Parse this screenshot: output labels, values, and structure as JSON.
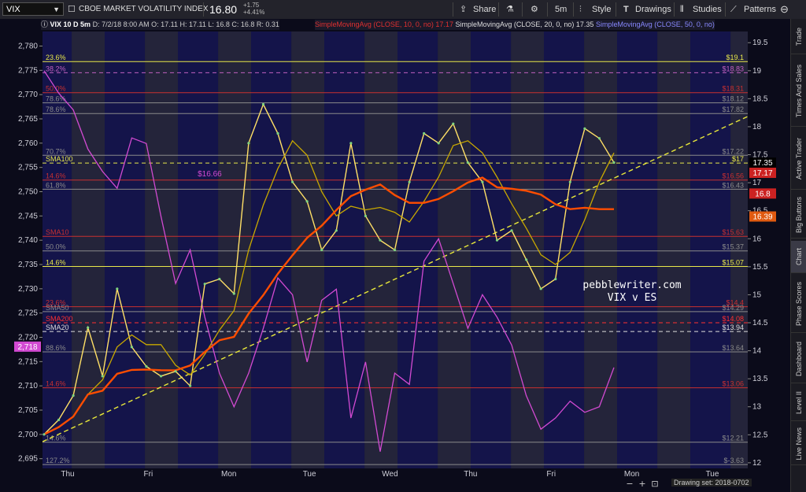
{
  "toolbar": {
    "symbol": "VIX",
    "instrument_name": "CBOE MARKET VOLATILITY INDEX",
    "last_price": "16.80",
    "change_abs": "+1.75",
    "change_pct": "+4.41%",
    "share": "Share",
    "timeframe": "5m",
    "style": "Style",
    "drawings": "Drawings",
    "studies": "Studies",
    "patterns": "Patterns"
  },
  "sidebar": {
    "tabs": [
      "Trade",
      "Times And Sales",
      "Active Trader",
      "Big Buttons",
      "Chart",
      "Phase Scores",
      "Dashboard",
      "Level II",
      "Live News"
    ],
    "active": "Chart"
  },
  "header": {
    "title": "VIX 10 D 5m",
    "date_info": "D: 7/2/18 8:00 AM",
    "ohlc": "O: 17.11 H: 17.11 L: 16.8 C: 16.8 R: 0.31",
    "sma10": "SimpleMovingAvg (CLOSE, 10, 0, no)",
    "sma10_val": "17.17",
    "sma20": "SimpleMovingAvg (CLOSE, 20, 0, no)",
    "sma20_val": "17.35",
    "sma50": "SimpleMovingAvg (CLOSE, 50, 0, no)"
  },
  "footer": {
    "drawing_set": "Drawing set: 2018-0702"
  },
  "colors": {
    "background": "#0b0b1a",
    "band_dark": "#14144a",
    "band_light": "#3a3a56",
    "vix_line": "#d24ad2",
    "sma10": "#ff7a1a",
    "sma20": "#c8a800",
    "sma50": "#ff4d00",
    "sma200": "#e03a16",
    "trendline": "#e8e83a",
    "fib_red": "#c83030",
    "fib_gray": "#8a8a8a",
    "fib_yellow": "#e8e84a",
    "watermark": "#ffffff"
  },
  "chart_data": {
    "type": "line",
    "title": "",
    "watermark": [
      "pebblewriter.com",
      "VIX v ES"
    ],
    "xlabel": "",
    "ylabel": "",
    "x_ticks": [
      "Thu",
      "Fri",
      "Mon",
      "Tue",
      "Wed",
      "Thu",
      "Fri",
      "Mon",
      "Tue"
    ],
    "left_axis": {
      "label": "ES",
      "ylim": [
        2693,
        2783
      ],
      "ticks": [
        2780,
        2775,
        2770,
        2765,
        2760,
        2755,
        2750,
        2745,
        2740,
        2735,
        2730,
        2725,
        2720,
        2715,
        2710,
        2705,
        2700,
        2695
      ],
      "marker": "2,718"
    },
    "right_axis": {
      "label": "VIX",
      "ylim": [
        11.9,
        19.7
      ],
      "ticks": [
        19.5,
        19,
        18.5,
        18,
        17.5,
        17,
        16.5,
        16,
        15.5,
        15,
        14.5,
        14,
        13.5,
        13,
        12.5,
        12
      ]
    },
    "price_tags": [
      {
        "label": "17.35",
        "value": 17.35,
        "color": "#ffffff",
        "bg": "#000000"
      },
      {
        "label": "17.17",
        "value": 17.17,
        "color": "#ffffff",
        "bg": "#cc2222"
      },
      {
        "label": "16.8",
        "value": 16.8,
        "color": "#ffffff",
        "bg": "#cc2222"
      },
      {
        "label": "16.39",
        "value": 16.39,
        "color": "#ffffff",
        "bg": "#e05a10"
      }
    ],
    "levels": [
      {
        "left_label": "23.6%",
        "right_label": "$19.1",
        "es": 2776.8,
        "color": "#e8e84a"
      },
      {
        "left_label": "38.2%",
        "right_label": "$18.83",
        "es": 2774.5,
        "color": "#c060c0",
        "dashed": true
      },
      {
        "left_label": "50.0%",
        "right_label": "$18.31",
        "es": 2770.4,
        "color": "#c83030"
      },
      {
        "left_label": "78.6%",
        "right_label": "$18.12",
        "es": 2768.3,
        "color": "#8a8a8a"
      },
      {
        "left_label": "78.6%",
        "right_label": "$17.82",
        "es": 2766.1,
        "color": "#8a8a8a"
      },
      {
        "left_label": "70.7%",
        "right_label": "$17.22",
        "es": 2757.5,
        "color": "#8a8a8a"
      },
      {
        "left_label": "SMA100",
        "right_label": "$17",
        "es": 2755.9,
        "color": "#e8e84a",
        "dashed": true
      },
      {
        "left_label": "14.6%",
        "right_label": "$16.56",
        "es": 2752.4,
        "color": "#c83030"
      },
      {
        "left_label": "61.8%",
        "right_label": "$16.43",
        "es": 2750.5,
        "color": "#8a8a8a"
      },
      {
        "left_label": "SMA10",
        "right_label": "$15.63",
        "es": 2740.8,
        "color": "#c83030"
      },
      {
        "left_label": "50.0%",
        "right_label": "$15.37",
        "es": 2737.8,
        "color": "#8a8a8a"
      },
      {
        "left_label": "14.6%",
        "right_label": "$15.07",
        "es": 2734.6,
        "color": "#e8e84a"
      },
      {
        "left_label": "23.6%",
        "right_label": "$14.4",
        "es": 2726.3,
        "color": "#c83030"
      },
      {
        "left_label": "SMA50",
        "right_label": "$14.29",
        "es": 2725.3,
        "color": "#8a8a8a"
      },
      {
        "left_label": "SMA200",
        "right_label": "$14.08",
        "es": 2723.0,
        "color": "#ff3030",
        "dashed": true
      },
      {
        "left_label": "SMA20",
        "right_label": "$13.94",
        "es": 2721.2,
        "color": "#dddddd",
        "dashed": true
      },
      {
        "left_label": "88.6%",
        "right_label": "$13.64",
        "es": 2717.0,
        "color": "#8a8a8a"
      },
      {
        "left_label": "14.6%",
        "right_label": "$13.06",
        "es": 2709.6,
        "color": "#c83030"
      },
      {
        "left_label": "14.6%",
        "right_label": "$12.21",
        "es": 2698.4,
        "color": "#8a8a8a"
      },
      {
        "left_label": "127.2%",
        "right_label": "$-3.63",
        "es": 2693.8,
        "color": "#8a8a8a"
      }
    ],
    "annotations": [
      {
        "text": "$16.66",
        "es": 2752.5,
        "x_frac": 0.22
      }
    ],
    "series": [
      {
        "name": "ES",
        "axis": "left",
        "values": [
          2700,
          2703,
          2708,
          2722,
          2712,
          2730,
          2718,
          2714,
          2712,
          2713,
          2710,
          2731,
          2732,
          2729,
          2760,
          2768,
          2762,
          2752,
          2748,
          2738,
          2742,
          2760,
          2745,
          2740,
          2738,
          2752,
          2762,
          2760,
          2764,
          2756,
          2752,
          2740,
          2742,
          2736,
          2730,
          2732,
          2752,
          2763,
          2761,
          2756
        ]
      },
      {
        "name": "VIX",
        "axis": "right",
        "values": [
          19.0,
          18.6,
          18.3,
          17.6,
          17.2,
          16.9,
          17.8,
          17.7,
          16.4,
          15.2,
          15.8,
          14.6,
          13.6,
          13.0,
          13.6,
          14.4,
          15.3,
          15.0,
          13.8,
          14.9,
          15.1,
          12.8,
          13.8,
          12.2,
          13.6,
          13.4,
          15.6,
          16.0,
          15.2,
          14.4,
          15.0,
          14.6,
          14.1,
          13.2,
          12.6,
          12.8,
          13.1,
          12.9,
          13.0,
          13.7
        ]
      }
    ],
    "grid": false
  }
}
